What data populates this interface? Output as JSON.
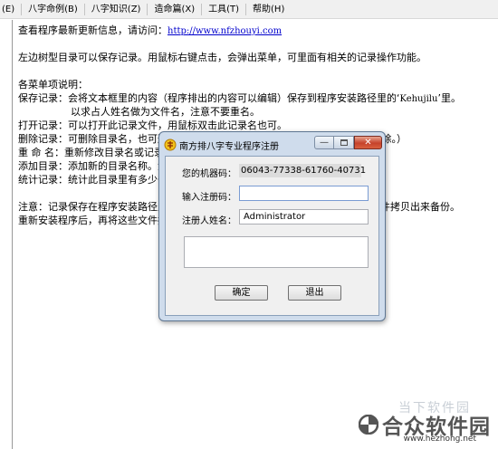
{
  "menubar": {
    "items": [
      {
        "label": "(E)"
      },
      {
        "label": "八字命例(B)"
      },
      {
        "label": "八字知识(Z)"
      },
      {
        "label": "造命篇(X)"
      },
      {
        "label": "工具(T)"
      },
      {
        "label": "帮助(H)"
      }
    ]
  },
  "editor": {
    "line1_text": "查看程序最新更新信息，请访问：",
    "line1_url": "http://www.nfzhouyi.com",
    "line2": "左边树型目录可以保存记录。用鼠标右键点击，会弹出菜单，可里面有相关的记录操作功能。",
    "line3": "各菜单项说明：",
    "line4_a": "保存记录：会将文本框里的内容（程序排出的内容可以编辑）保存到程序安装路径里的‘",
    "line4_b": "Kehujilu",
    "line4_c": "’里。",
    "line5": "以求占人姓名做为文件名，注意不要重名。",
    "line6": "打开记录：可以打开此记录文件，用鼠标双击此记录名也可。",
    "line7": "删除记录：可删除目录名，也可删除记录名。（如果删除目录，里面的记录也将被删除。）",
    "line8": "重 命 名：重新修改目录名或记录",
    "line9": "添加目录：添加新的目录名称。添",
    "line10": "统计记录：统计此目录里有多少条",
    "line11_a": "注意：记录保存在程序安装路径里",
    "line11_b": "文件拷贝出来备份。",
    "line12": "重新安装程序后，再将这些文件拷"
  },
  "dialog": {
    "title": "南方排八字专业程序注册",
    "machine_code_label": "您的机器码：",
    "machine_code_value": "06043-77338-61760-40731",
    "reg_code_label": "输入注册码：",
    "reg_code_value": "",
    "user_name_label": "注册人姓名：",
    "user_name_value": "Administrator",
    "ok_label": "确定",
    "exit_label": "退出"
  },
  "watermark": {
    "top_text": "当下软件园",
    "brand": "合众软件园",
    "url": "www.hezhong.net"
  },
  "colors": {
    "dialog_frame": "#cfdcec",
    "close_button": "#c6422b",
    "link": "#0000cc"
  }
}
